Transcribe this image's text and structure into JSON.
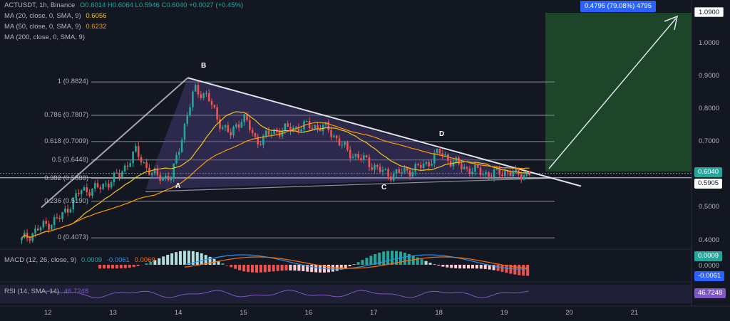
{
  "symbol_line": {
    "symbol": "ACTUSDT, 1h, Binance",
    "ohlc": "O0.6014 H0.6064 L0.5946 C0.6040 +0.0027 (+0.45%)"
  },
  "indicators": [
    {
      "label": "MA (20, close, 0, SMA, 9)",
      "value": "0.6056",
      "color": "#f5c518"
    },
    {
      "label": "MA (50, close, 0, SMA, 9)",
      "value": "0.6232",
      "color": "#ff9800"
    },
    {
      "label": "MA (200, close, 0, SMA, 9)",
      "value": "",
      "color": "#b2b5be"
    }
  ],
  "macd_label": {
    "label": "MACD (12, 26, close, 9)",
    "v1": "0.0009",
    "v2": "-0.0061",
    "v3": "0.0069"
  },
  "rsi_label": {
    "label": "RSI (14, SMA, 14)",
    "value": "46.7248"
  },
  "measure_label": "0.4795 (79.08%) 4795",
  "price_tags": {
    "target": "1.0900",
    "current": "0.6040",
    "support": "0.5905",
    "macd": "0.0009",
    "macd_zero": "0.0000",
    "macd_signal": "-0.0061",
    "rsi": "46.7248"
  },
  "colors": {
    "bg": "#131722",
    "up": "#26a69a",
    "down": "#ef5350",
    "ma20": "#f5c518",
    "ma50": "#ff9800",
    "trend": "#e0e3eb",
    "fib": "#787b86",
    "triangle": "#5b4b9a",
    "target_zone": "#1e4d2b",
    "rsi": "#7e57c2",
    "macd_line": "#2196f3",
    "signal_line": "#ff6d00",
    "accent": "#2962ff"
  },
  "points": {
    "A": "A",
    "B": "B",
    "C": "C",
    "D": "D"
  },
  "chart_data": {
    "type": "candlestick",
    "x_ticks": [
      "12",
      "13",
      "14",
      "15",
      "16",
      "17",
      "18",
      "19",
      "20",
      "21"
    ],
    "y_ticks": [
      "1.0000",
      "0.9000",
      "0.8000",
      "0.7000",
      "0.6000",
      "0.5000",
      "0.4000"
    ],
    "ylim": [
      0.335,
      1.1
    ],
    "fib_levels": [
      {
        "label": "1 (0.8824)",
        "price": 0.8824
      },
      {
        "label": "0.786 (0.7807)",
        "price": 0.7807
      },
      {
        "label": "0.618 (0.7009)",
        "price": 0.7009
      },
      {
        "label": "0.5 (0.6448)",
        "price": 0.6448
      },
      {
        "label": "0.382 (0.5888)",
        "price": 0.5888
      },
      {
        "label": "0.236 (0.5190)",
        "price": 0.519
      },
      {
        "label": "0 (0.4073)",
        "price": 0.4073
      }
    ],
    "waypoints": [
      [
        11.6,
        0.4
      ],
      [
        11.9,
        0.44
      ],
      [
        12.2,
        0.47
      ],
      [
        12.5,
        0.55
      ],
      [
        12.8,
        0.56
      ],
      [
        13.1,
        0.6
      ],
      [
        13.35,
        0.67
      ],
      [
        13.6,
        0.6
      ],
      [
        13.9,
        0.59
      ],
      [
        14.1,
        0.75
      ],
      [
        14.25,
        0.86
      ],
      [
        14.45,
        0.84
      ],
      [
        14.6,
        0.77
      ],
      [
        14.8,
        0.72
      ],
      [
        15.0,
        0.78
      ],
      [
        15.2,
        0.7
      ],
      [
        15.45,
        0.73
      ],
      [
        15.7,
        0.74
      ],
      [
        16.0,
        0.75
      ],
      [
        16.3,
        0.74
      ],
      [
        16.6,
        0.67
      ],
      [
        16.9,
        0.64
      ],
      [
        17.2,
        0.6
      ],
      [
        17.5,
        0.61
      ],
      [
        17.8,
        0.63
      ],
      [
        18.0,
        0.67
      ],
      [
        18.2,
        0.64
      ],
      [
        18.4,
        0.62
      ],
      [
        18.6,
        0.61
      ],
      [
        18.8,
        0.6
      ],
      [
        19.0,
        0.61
      ],
      [
        19.2,
        0.6
      ],
      [
        19.4,
        0.604
      ]
    ],
    "current_price": 0.604,
    "support_price": 0.5905,
    "target_price": 1.09,
    "rsi_last": 46.7248
  }
}
